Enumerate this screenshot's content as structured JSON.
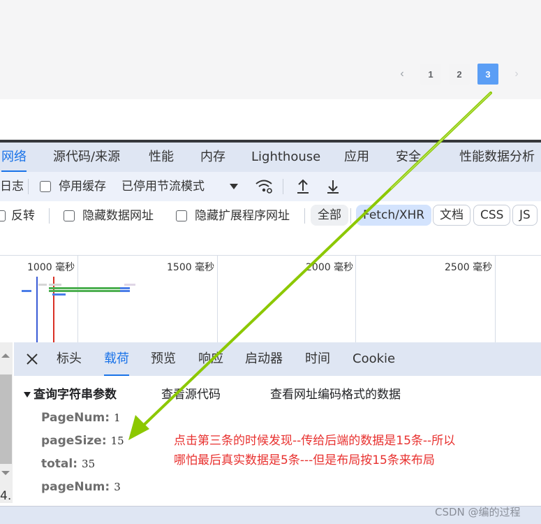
{
  "pagination": {
    "prev_icon": "chevron-left-icon",
    "pages": [
      "1",
      "2",
      "3"
    ],
    "active_page": "3",
    "next_icon": "chevron-right-icon"
  },
  "devtools": {
    "tabs": [
      "网络",
      "源代码/来源",
      "性能",
      "内存",
      "Lighthouse",
      "应用",
      "安全",
      "性能数据分析"
    ],
    "active_tab": "网络",
    "toolbar": {
      "log_label": "日志",
      "disable_cache_label": "停用缓存",
      "throttle_label": "已停用节流模式",
      "wifi_icon": "network-conditions-icon",
      "upload_icon": "upload-icon",
      "download_icon": "download-icon"
    },
    "filter": {
      "invert_label": "反转",
      "hide_data_urls_label": "隐藏数据网址",
      "hide_ext_urls_label": "隐藏扩展程序网址",
      "types": [
        "全部",
        "Fetch/XHR",
        "文档",
        "CSS",
        "JS"
      ],
      "selected_type": "Fetch/XHR"
    },
    "timeline": {
      "ticks": [
        "1000 毫秒",
        "1500 毫秒",
        "2000 毫秒",
        "2500 毫秒"
      ]
    },
    "details": {
      "tabs": [
        "标头",
        "载荷",
        "预览",
        "响应",
        "启动器",
        "时间",
        "Cookie"
      ],
      "active_tab": "载荷",
      "section_title": "查询字符串参数",
      "view_source_label": "查看源代码",
      "view_url_encoded_label": "查看网址编码格式的数据",
      "params": [
        {
          "key": "PageNum:",
          "value": "1"
        },
        {
          "key": "pageSize:",
          "value": "15"
        },
        {
          "key": "total:",
          "value": "35"
        },
        {
          "key": "pageNum:",
          "value": "3"
        }
      ]
    },
    "left_number": "4."
  },
  "annotation": {
    "line1": "点击第三条的时候发现--传给后端的数据是15条--所以",
    "line2": "哪怕最后真实数据是5条---但是布局按15条来布局"
  },
  "watermark": "CSDN @编的过程",
  "colors": {
    "accent": "#1a73e8",
    "active_page": "#5b9ef5",
    "annotation": "#e8312f",
    "arrow": "#8cc800"
  }
}
